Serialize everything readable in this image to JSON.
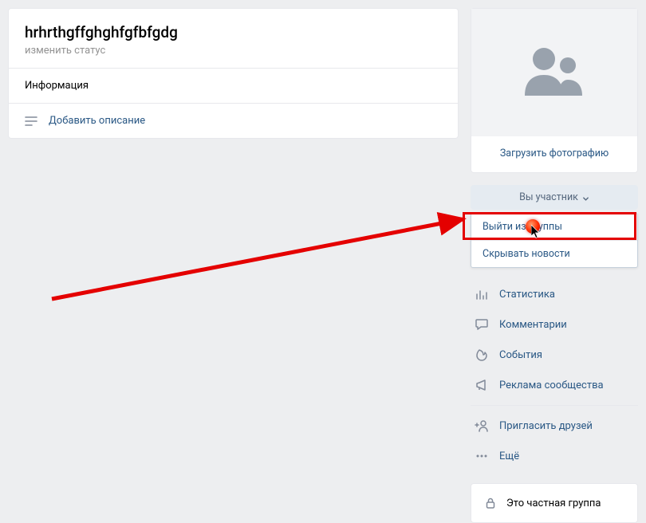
{
  "header": {
    "title": "hrhrthgffghghfgfbfgdg",
    "status_placeholder": "изменить статус",
    "info_label": "Информация",
    "add_description": "Добавить описание"
  },
  "side": {
    "upload_photo": "Загрузить фотографию",
    "member_button": "Вы участник",
    "dropdown": {
      "leave": "Выйти из группы",
      "hide_news": "Скрывать новости"
    },
    "menu": {
      "stats": "Статистика",
      "comments": "Комментарии",
      "events": "События",
      "ads": "Реклама сообщества",
      "invite": "Пригласить друзей",
      "more": "Ещё"
    },
    "private_group": "Это частная группа"
  }
}
